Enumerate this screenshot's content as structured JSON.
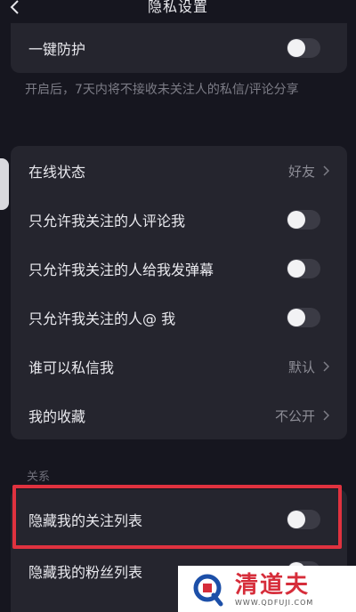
{
  "header": {
    "title": "隐私设置"
  },
  "protection": {
    "label": "一键防护",
    "enabled": false,
    "description": "开启后，7天内将不接收未关注人的私信/评论分享"
  },
  "privacy_items": [
    {
      "label": "在线状态",
      "type": "link",
      "value": "好友"
    },
    {
      "label": "只允许我关注的人评论我",
      "type": "toggle",
      "enabled": false
    },
    {
      "label": "只允许我关注的人给我发弹幕",
      "type": "toggle",
      "enabled": false
    },
    {
      "label": "只允许我关注的人@ 我",
      "type": "toggle",
      "enabled": false
    },
    {
      "label": "谁可以私信我",
      "type": "link",
      "value": "默认"
    },
    {
      "label": "我的收藏",
      "type": "link",
      "value": "不公开"
    }
  ],
  "relations": {
    "section_label": "关系",
    "items": [
      {
        "label": "隐藏我的关注列表",
        "type": "toggle",
        "enabled": false
      },
      {
        "label": "隐藏我的粉丝列表",
        "type": "toggle",
        "enabled": false
      }
    ]
  },
  "watermark": {
    "title": "清道夫",
    "url": "WWW.QDFUJI.COM"
  },
  "colors": {
    "highlight": "#e0323f",
    "background": "#16161f",
    "card": "#25252e"
  }
}
